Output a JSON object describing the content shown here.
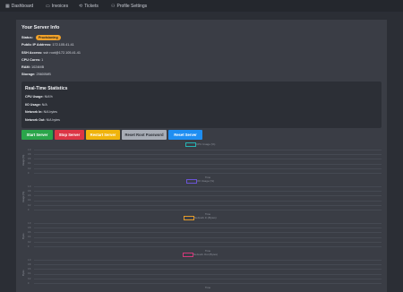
{
  "nav": {
    "items": [
      {
        "label": "Dashboard",
        "icon": "dashboard-icon",
        "glyph": "▦"
      },
      {
        "label": "Invoices",
        "icon": "invoice-icon",
        "glyph": "▭"
      },
      {
        "label": "Tickets",
        "icon": "ticket-icon",
        "glyph": "⟲"
      },
      {
        "label": "Profile Settings",
        "icon": "user-icon",
        "glyph": "⚇"
      }
    ]
  },
  "server_info": {
    "title": "Your Server Info",
    "status_label": "Status:",
    "status_value": "Provisioning",
    "ip_label": "Public IP Address:",
    "ip_value": "172.105.41.41",
    "ssh_label": "SSH Access:",
    "ssh_value": "ssh root@172.105.41.41",
    "cpu_label": "CPU Cores:",
    "cpu_value": "1",
    "ram_label": "RAM:",
    "ram_value": "1024MB",
    "storage_label": "Storage:",
    "storage_value": "25600MB"
  },
  "realtime": {
    "title": "Real-Time Statistics",
    "cpu_label": "CPU Usage:",
    "cpu_value": "N/A%",
    "io_label": "I/O Usage:",
    "io_value": "N/A",
    "net_in_label": "Network In:",
    "net_in_value": "N/A bytes",
    "net_out_label": "Network Out:",
    "net_out_value": "N/A bytes"
  },
  "actions": {
    "start": "Start Server",
    "stop": "Stop Server",
    "restart": "Restart Server",
    "reset_password": "Reset Root Password",
    "reset": "Reset Server"
  },
  "colors": {
    "start": "#2aa54a",
    "stop": "#dc3545",
    "restart": "#f0b40d",
    "reset_password": "#a8adb6",
    "reset": "#1e8ef2",
    "cpu": "#26b3b3",
    "io": "#6a54d6",
    "net_in": "#e39a2a",
    "net_out": "#d4387a"
  },
  "charts": [
    {
      "legend": "CPU Usage (%)",
      "color_key": "cpu",
      "ylabel": "Usage (%)",
      "xlabel": "Time",
      "ticks": [
        "1.0",
        "0.8",
        "0.6",
        "0.4",
        "0.2",
        "0"
      ]
    },
    {
      "legend": "I/O Usage (%)",
      "color_key": "io",
      "ylabel": "Usage (%)",
      "xlabel": "Time",
      "ticks": [
        "1.0",
        "0.8",
        "0.6",
        "0.4",
        "0.2",
        "0"
      ]
    },
    {
      "legend": "Network In (Bytes)",
      "color_key": "net_in",
      "ylabel": "Bytes",
      "xlabel": "Time",
      "ticks": [
        "1.0",
        "0.8",
        "0.6",
        "0.4",
        "0.2",
        "0"
      ]
    },
    {
      "legend": "Network Out (Bytes)",
      "color_key": "net_out",
      "ylabel": "Bytes",
      "xlabel": "Time",
      "ticks": [
        "1.0",
        "0.8",
        "0.6",
        "0.4",
        "0.2",
        "0"
      ]
    }
  ]
}
